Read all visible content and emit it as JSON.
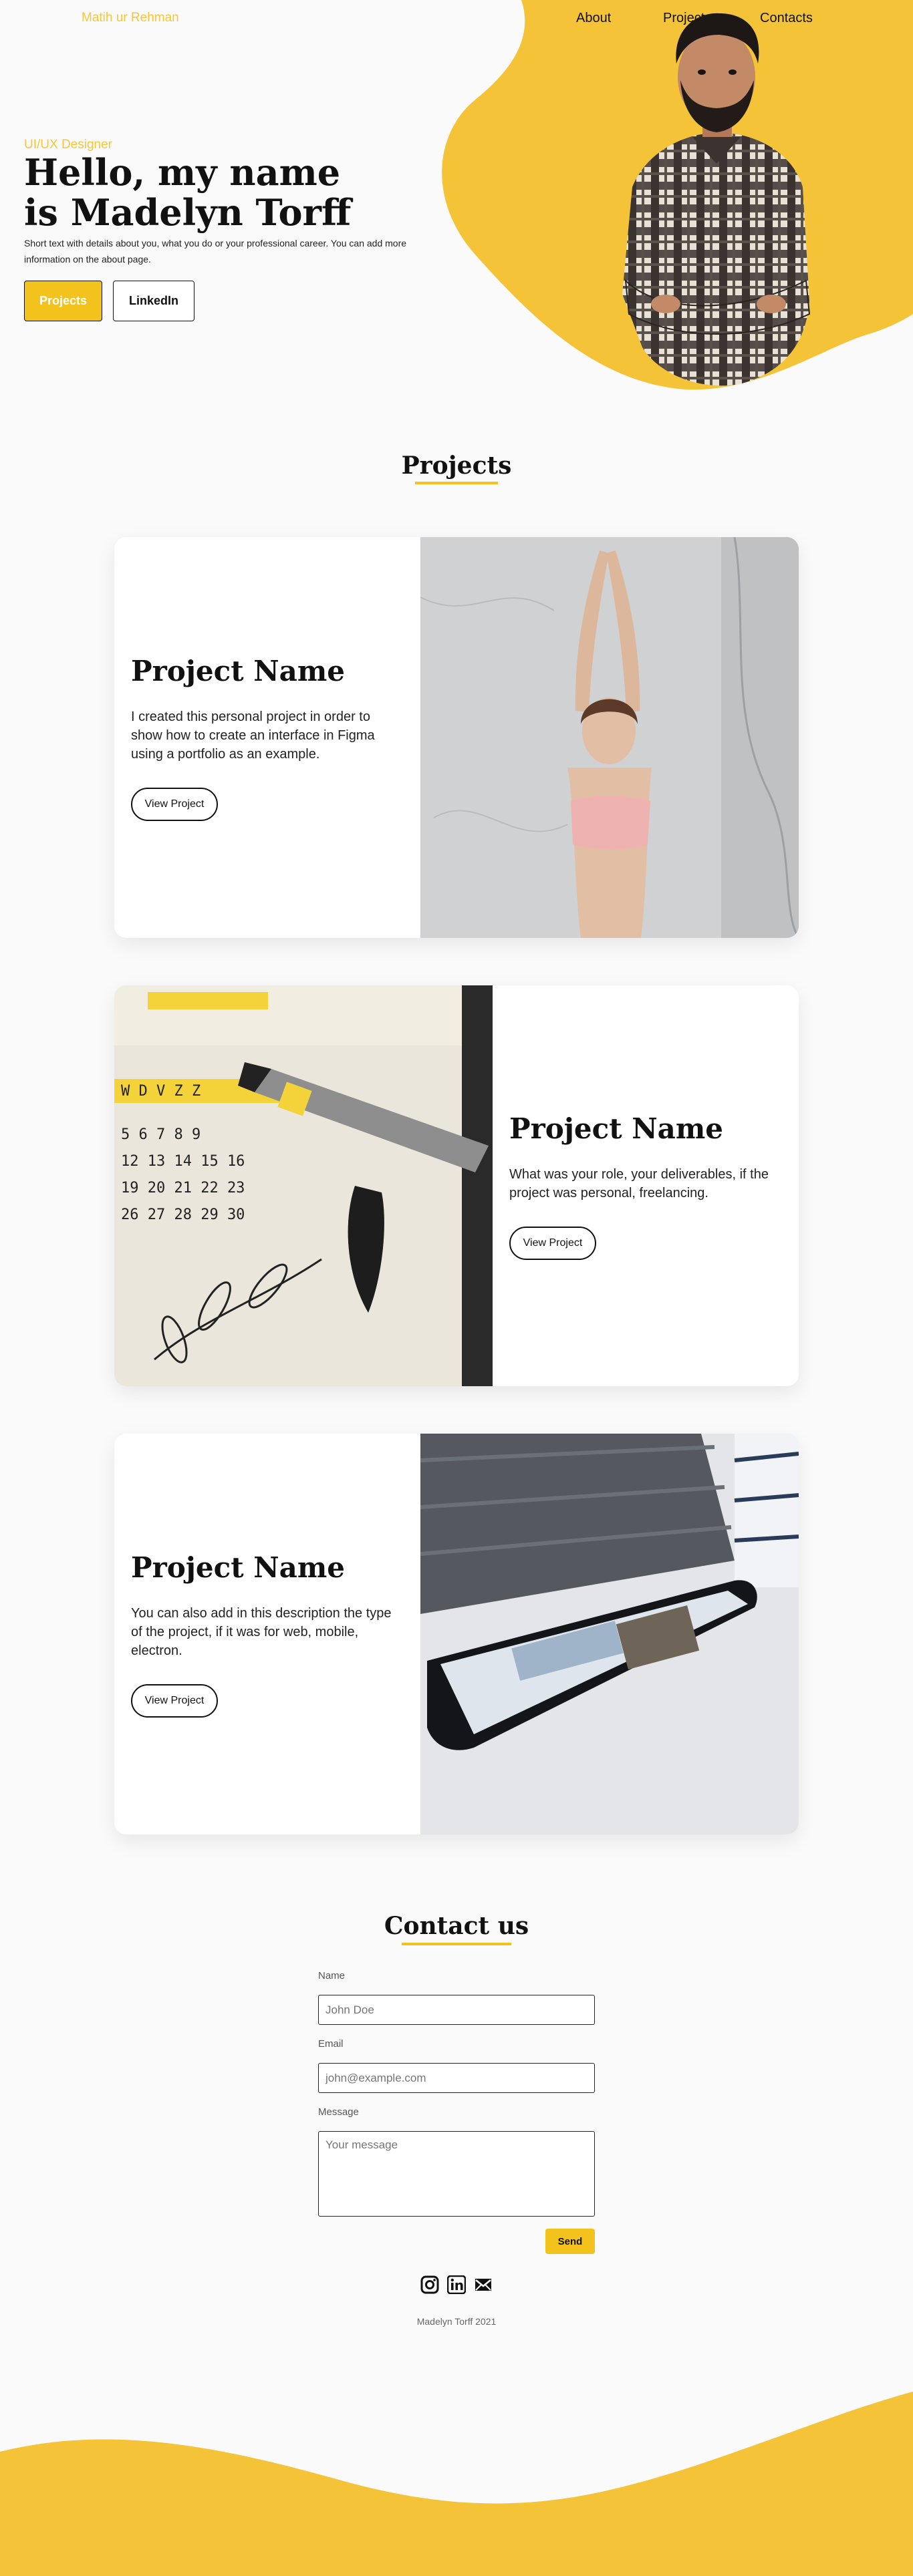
{
  "header": {
    "brand": "Matih ur Rehman",
    "nav": [
      "About",
      "Projects",
      "Contacts"
    ]
  },
  "hero": {
    "role": "UI/UX Designer",
    "title_line1": "Hello, my name",
    "title_line2": "is Madelyn Torff",
    "description": "Short text with details about you, what you do or your professional career. You can add more information on the about page.",
    "btn_projects": "Projects",
    "btn_linkedin": "LinkedIn"
  },
  "projects": {
    "heading": "Projects",
    "items": [
      {
        "title": "Project Name",
        "description": "I created this personal project in order to show how to create an interface in Figma using a portfolio as an example.",
        "button": "View Project"
      },
      {
        "title": "Project Name",
        "description": "What was your role, your deliverables, if the project was personal, freelancing.",
        "button": "View Project"
      },
      {
        "title": "Project Name",
        "description": "You can also add in this description the type of the project, if it was for web, mobile, electron.",
        "button": "View Project"
      }
    ]
  },
  "contact": {
    "heading": "Contact us",
    "name_label": "Name",
    "name_placeholder": "John Doe",
    "email_label": "Email",
    "email_placeholder": "john@example.com",
    "message_label": "Message",
    "message_placeholder": "Your message",
    "send": "Send"
  },
  "footer": {
    "copyright": "Madelyn Torff 2021"
  },
  "colors": {
    "accent": "#f3c21c",
    "blob": "#f5c337",
    "background": "#fafafa"
  },
  "icons": [
    "instagram-icon",
    "linkedin-icon",
    "mail-icon"
  ]
}
